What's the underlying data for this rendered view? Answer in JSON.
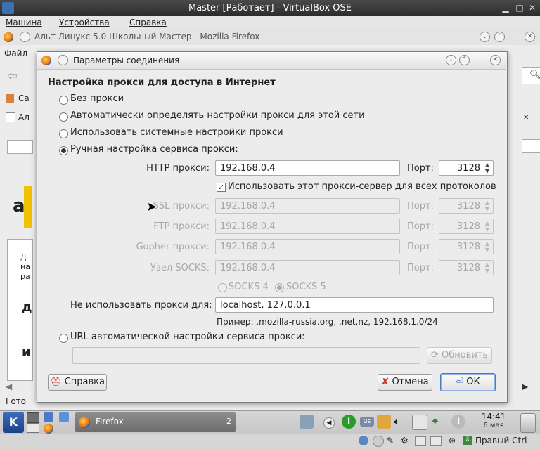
{
  "host": {
    "title": "Master [Работает] - VirtualBox OSE",
    "menu": [
      "Машина",
      "Устройства",
      "Справка"
    ],
    "status_right": "Правый Ctrl"
  },
  "firefox": {
    "title": "Альт Линукс 5.0 Школьный Мастер - Mozilla Firefox",
    "menu_peek": "Файл",
    "bookmark_peek": "Са",
    "tab_peek": "Ал",
    "status_peek": "Гото",
    "page_peek": [
      "Д",
      "на",
      "и",
      "ра",
      "д",
      "и"
    ]
  },
  "dialog": {
    "title": "Параметры соединения",
    "heading": "Настройка прокси для доступа в Интернет",
    "radios": [
      {
        "label": "Без прокси",
        "checked": false
      },
      {
        "label": "Автоматически определять настройки прокси для этой сети",
        "checked": false
      },
      {
        "label": "Использовать системные настройки прокси",
        "checked": false
      },
      {
        "label": "Ручная настройка сервиса прокси:",
        "checked": true
      }
    ],
    "http": {
      "label": "HTTP прокси:",
      "value": "192.168.0.4",
      "port_label": "Порт:",
      "port": "3128"
    },
    "use_all_label": "Использовать этот прокси-сервер для всех протоколов",
    "use_all_checked": true,
    "ssl": {
      "label": "SSL прокси:",
      "value": "192.168.0.4",
      "port_label": "Порт:",
      "port": "3128"
    },
    "ftp": {
      "label": "FTP прокси:",
      "value": "192.168.0.4",
      "port_label": "Порт:",
      "port": "3128"
    },
    "gopher": {
      "label": "Gopher прокси:",
      "value": "192.168.0.4",
      "port_label": "Порт:",
      "port": "3128"
    },
    "socks": {
      "label": "Узел SOCKS:",
      "value": "192.168.0.4",
      "port_label": "Порт:",
      "port": "3128"
    },
    "socks4": "SOCKS 4",
    "socks5": "SOCKS 5",
    "no_proxy": {
      "label": "Не использовать прокси для:",
      "value": "localhost, 127.0.0.1"
    },
    "example": "Пример: .mozilla-russia.org, .net.nz, 192.168.1.0/24",
    "auto_url_label": "URL автоматической настройки сервиса прокси:",
    "auto_url_value": "",
    "reload_button": "Обновить",
    "help_button": "Справка",
    "cancel_button": "Отмена",
    "ok_button": "ОК"
  },
  "taskbar": {
    "task_label": "Firefox",
    "task_count": "2",
    "time": "14:41",
    "date": "6 мая",
    "keyboard": "us"
  },
  "colors": {
    "accent": "#3b6cc0",
    "default_button_border": "#4a78c2"
  }
}
